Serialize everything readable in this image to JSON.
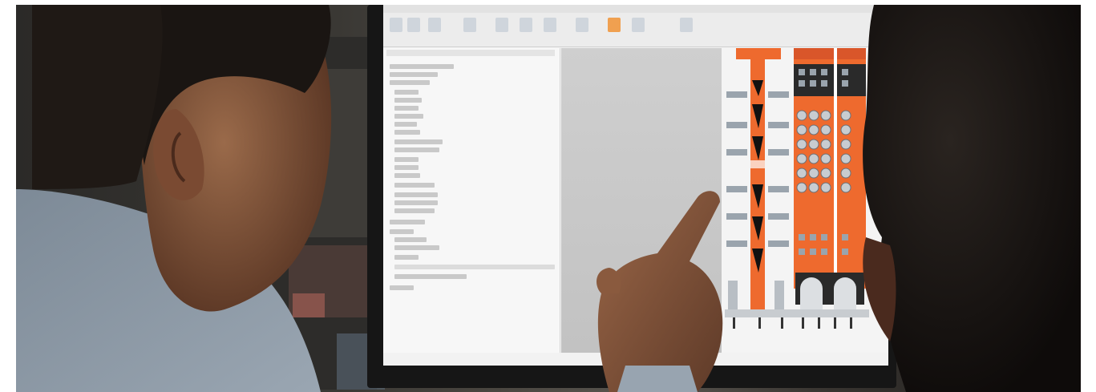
{
  "scene": {
    "description_hidden": "",
    "colors": {
      "accent_orange": "#ee6a2e",
      "screen_bg": "#f2f2f2",
      "taskbar": "#1e2a3a",
      "shirt": "#8a96a3",
      "skin": "#8b5a3c"
    },
    "icons": [
      "windows-start-icon",
      "taskbar-app-icon"
    ]
  }
}
